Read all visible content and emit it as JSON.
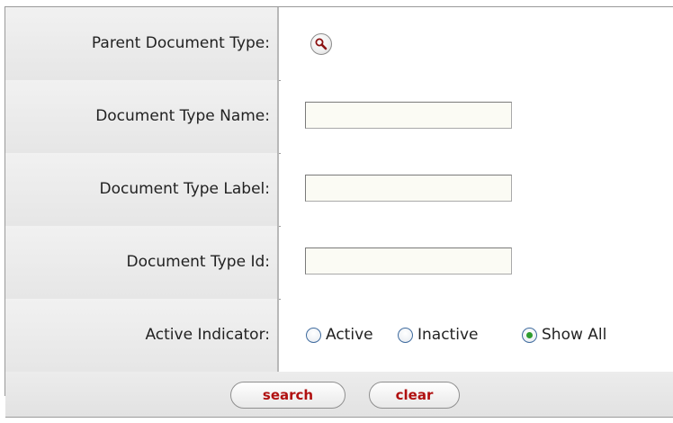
{
  "form": {
    "parent_document_type": {
      "label": "Parent Document Type:",
      "lookup_icon": "search-icon"
    },
    "document_type_name": {
      "label": "Document Type Name:",
      "value": ""
    },
    "document_type_label": {
      "label": "Document Type Label:",
      "value": ""
    },
    "document_type_id": {
      "label": "Document Type Id:",
      "value": ""
    },
    "active_indicator": {
      "label": "Active Indicator:",
      "options": [
        {
          "label": "Active",
          "selected": false
        },
        {
          "label": "Inactive",
          "selected": false
        },
        {
          "label": "Show All",
          "selected": true
        }
      ]
    }
  },
  "buttons": {
    "search_label": "search",
    "clear_label": "clear"
  },
  "colors": {
    "button_text": "#b01010",
    "radio_selected": "#2e9c2e",
    "label_bg": "#ebebeb"
  }
}
